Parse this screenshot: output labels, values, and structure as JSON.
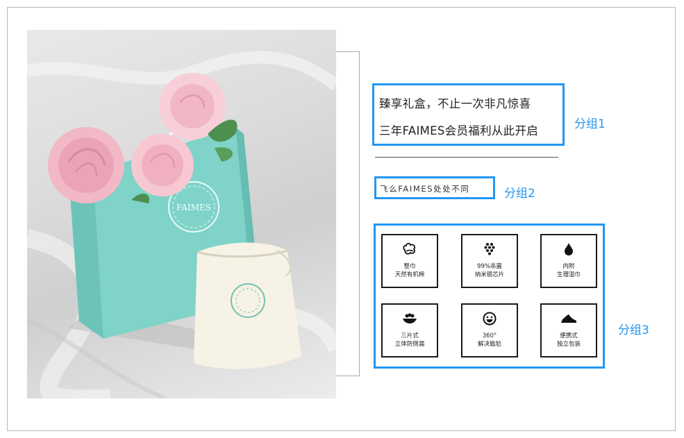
{
  "group1": {
    "line1": "臻享礼盒，不止一次非凡惊喜",
    "line2": "三年FAIMES会员福利从此开启",
    "label": "分组1"
  },
  "group2": {
    "text": "飞么FAIMES处处不同",
    "label": "分组2"
  },
  "group3": {
    "label": "分组3",
    "features": [
      {
        "icon": "cotton-icon",
        "line1": "整巾",
        "line2": "天然有机棉"
      },
      {
        "icon": "chip-icon",
        "line1": "99%杀菌",
        "line2": "纳米银芯片"
      },
      {
        "icon": "drop-icon",
        "line1": "内附",
        "line2": "生理湿巾"
      },
      {
        "icon": "layers-icon",
        "line1": "三片式",
        "line2": "立体防侧漏"
      },
      {
        "icon": "smile-icon",
        "line1": "360°",
        "line2": "解决尴尬"
      },
      {
        "icon": "shoe-icon",
        "line1": "便携式",
        "line2": "独立包装"
      }
    ]
  },
  "photo": {
    "bag_brand": "FAIMES"
  },
  "colors": {
    "accent": "#2196f3",
    "bag": "#7fd3c8"
  }
}
